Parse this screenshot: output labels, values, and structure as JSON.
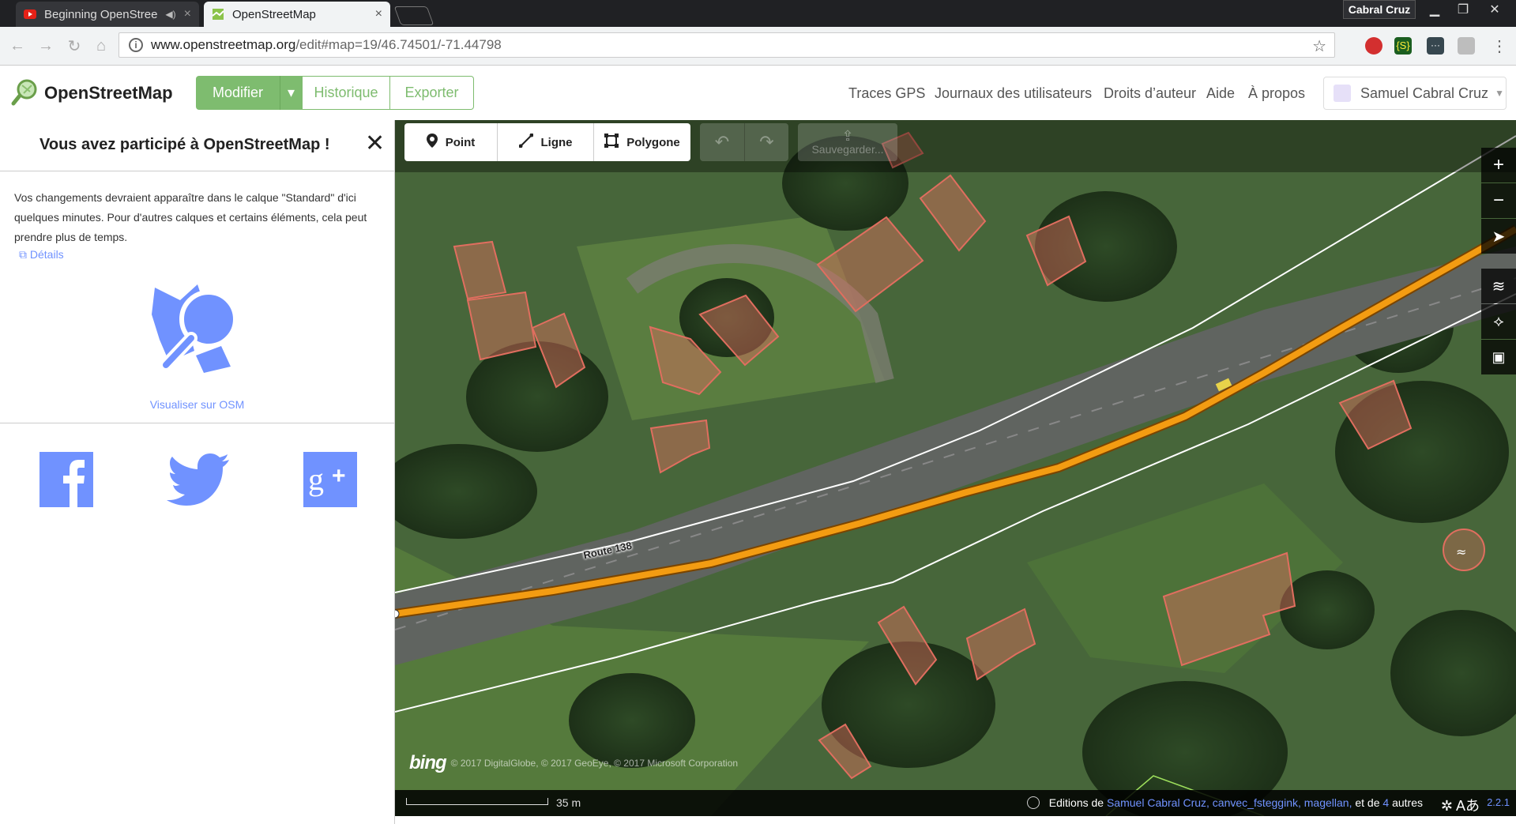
{
  "browser": {
    "tabs": [
      {
        "title": "Beginning OpenStree",
        "favicon": "youtube-icon",
        "close": "×"
      },
      {
        "title": "OpenStreetMap",
        "favicon": "osm-map-icon",
        "close": "×"
      }
    ],
    "profile_name": "Cabral Cruz",
    "url_host": "www.openstreetmap.org",
    "url_path": "/edit#map=19/46.74501/-71.44798"
  },
  "header": {
    "site_title": "OpenStreetMap",
    "buttons": {
      "modifier": "Modifier",
      "historique": "Historique",
      "exporter": "Exporter"
    },
    "links": [
      "Traces GPS",
      "Journaux des utilisateurs",
      "Droits d’auteur",
      "Aide",
      "À propos"
    ],
    "user_name": "Samuel Cabral Cruz",
    "accent_color": "#7ebc6f"
  },
  "sidebar": {
    "title": "Vous avez participé à OpenStreetMap !",
    "message": "Vos changements devraient apparaître dans le calque \"Standard\" d'ici quelques minutes. Pour d'autres calques et certains éléments, cela peut prendre plus de temps.",
    "details_link": "Détails",
    "view_osm": "Visualiser sur OSM",
    "social": [
      "facebook-icon",
      "twitter-icon",
      "google-plus-icon"
    ],
    "link_color": "#7092ff"
  },
  "map": {
    "tools": {
      "point": "Point",
      "line": "Ligne",
      "area": "Polygone",
      "save": "Sauvegarder..."
    },
    "road_label": "Route 138",
    "attribution_logo": "bing",
    "attribution": "© 2017 DigitalGlobe, © 2017 GeoEye, © 2017 Microsoft Corporation",
    "scale": "35 m",
    "edits_prefix": "Editions de",
    "edits_users": "Samuel Cabral Cruz, canvec_fsteggink, magellan,",
    "edits_mid": "et de",
    "edits_count": "4",
    "edits_suffix": "autres",
    "version": "2.2.1"
  }
}
